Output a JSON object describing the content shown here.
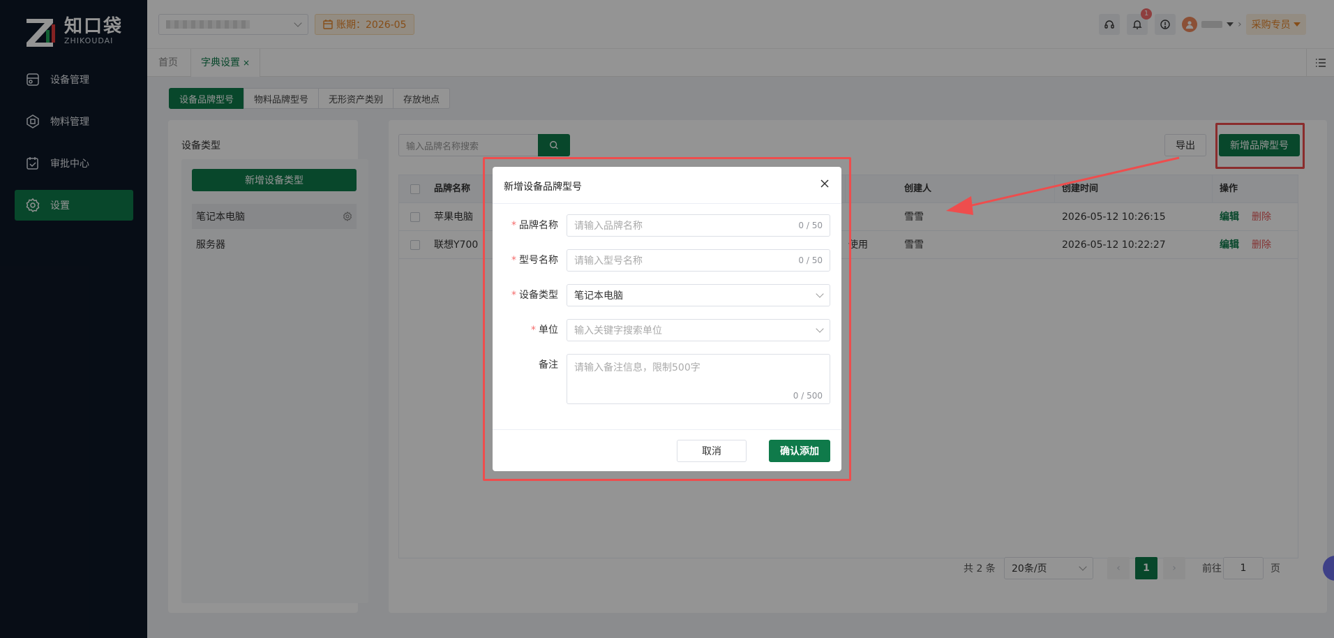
{
  "colors": {
    "brand": "#0f7a4a",
    "sidebar_bg": "#0d1726",
    "danger": "#e35a5a",
    "warning": "#e6862a",
    "annotation": "#ee4d4d"
  },
  "logo": {
    "cn": "知口袋",
    "en": "ZHIKOUDAI"
  },
  "nav": [
    {
      "label": "设备管理",
      "icon": "device-icon"
    },
    {
      "label": "物料管理",
      "icon": "material-icon"
    },
    {
      "label": "审批中心",
      "icon": "approval-icon"
    },
    {
      "label": "设置",
      "icon": "gear-icon",
      "active": true
    }
  ],
  "header": {
    "period": "账期：2026-05",
    "notifications_count": "1",
    "role": "采购专员"
  },
  "tabs": {
    "home": "首页",
    "active": "字典设置",
    "close": "×"
  },
  "segments": [
    "设备品牌型号",
    "物料品牌型号",
    "无形资产类别",
    "存放地点"
  ],
  "left_panel": {
    "title": "设备类型",
    "add_button": "新增设备类型",
    "types": [
      "笔记本电脑",
      "服务器"
    ]
  },
  "toolbar": {
    "search_placeholder": "输入品牌名称搜索",
    "export": "导出",
    "add": "新增品牌型号"
  },
  "table": {
    "columns": [
      "品牌名称",
      "创建人",
      "创建时间",
      "操作"
    ],
    "rows": [
      {
        "brand": "苹果电脑",
        "extra": "",
        "creator": "雪雪",
        "created": "2026-05-12 10:26:15"
      },
      {
        "brand": "联想Y700",
        "extra": "使用",
        "creator": "雪雪",
        "created": "2026-05-12 10:22:27"
      }
    ],
    "edit": "编辑",
    "delete": "删除"
  },
  "pager": {
    "total": "共 2 条",
    "page_size": "20条/页",
    "current": "1",
    "goto": "前往",
    "goto_value": "1",
    "page_unit": "页"
  },
  "dialog": {
    "title": "新增设备品牌型号",
    "fields": {
      "brand": {
        "label": "品牌名称",
        "placeholder": "请输入品牌名称",
        "count": "0 / 50"
      },
      "model": {
        "label": "型号名称",
        "placeholder": "请输入型号名称",
        "count": "0 / 50"
      },
      "type": {
        "label": "设备类型",
        "value": "笔记本电脑"
      },
      "unit": {
        "label": "单位",
        "placeholder": "输入关键字搜索单位"
      },
      "remark": {
        "label": "备注",
        "placeholder": "请输入备注信息，限制500字",
        "count": "0 / 500"
      }
    },
    "required_mark": "*",
    "cancel": "取消",
    "confirm": "确认添加"
  }
}
